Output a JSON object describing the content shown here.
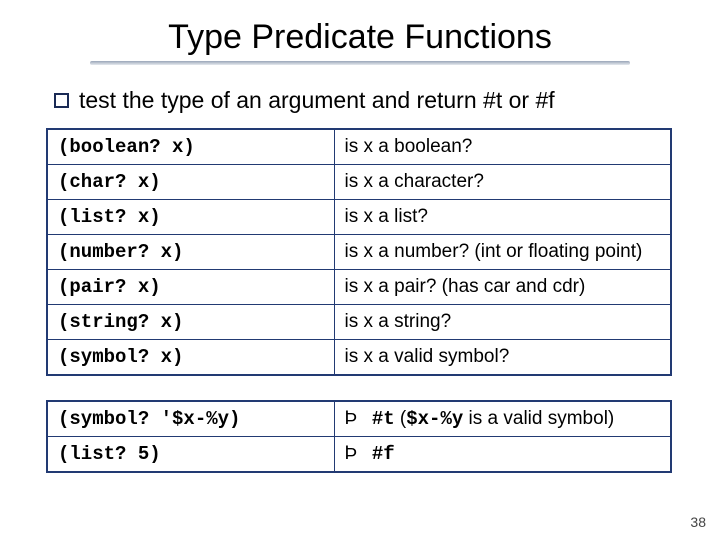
{
  "title": "Type Predicate Functions",
  "bullet": "test the type of an argument and return #t or #f",
  "table1": [
    {
      "code": "(boolean? x)",
      "desc": "is x a boolean?"
    },
    {
      "code": "(char? x)",
      "desc": "is x a character?"
    },
    {
      "code": "(list? x)",
      "desc": "is x a list?"
    },
    {
      "code": "(number? x)",
      "desc": "is x a number? (int or floating point)"
    },
    {
      "code": "(pair? x)",
      "desc": "is x a pair? (has car and cdr)"
    },
    {
      "code": "(string? x)",
      "desc": "is x a string?"
    },
    {
      "code": "(symbol? x)",
      "desc": "is x a valid symbol?"
    }
  ],
  "table2": [
    {
      "code": "(symbol? '$x-%y)",
      "arrow": "Þ",
      "value": "#t",
      "note_open": "  (",
      "note_sym": "$x-%y",
      "note_close": " is a valid symbol)"
    },
    {
      "code": "(list? 5)",
      "arrow": "Þ",
      "value": "#f",
      "note_open": "",
      "note_sym": "",
      "note_close": ""
    }
  ],
  "slidenum": "38"
}
